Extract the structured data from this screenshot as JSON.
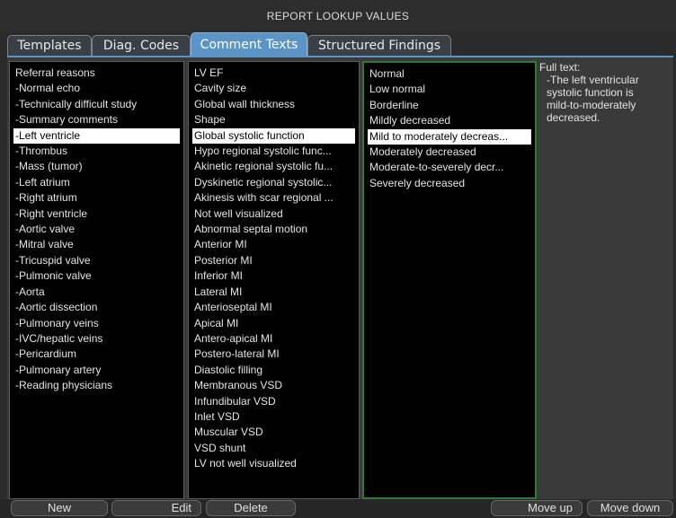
{
  "title": "REPORT LOOKUP VALUES",
  "tabs": [
    {
      "label": "Templates"
    },
    {
      "label": "Diag. Codes"
    },
    {
      "label": "Comment Texts"
    },
    {
      "label": "Structured Findings"
    }
  ],
  "col1": {
    "items": [
      "Referral reasons",
      "-Normal echo",
      "-Technically difficult study",
      "-Summary comments",
      "-Left ventricle",
      "-Thrombus",
      "-Mass (tumor)",
      "-Left atrium",
      "-Right atrium",
      "-Right ventricle",
      "-Aortic valve",
      "-Mitral valve",
      "-Tricuspid valve",
      "-Pulmonic valve",
      "-Aorta",
      "-Aortic dissection",
      "-Pulmonary veins",
      "-IVC/hepatic veins",
      "-Pericardium",
      "-Pulmonary artery",
      "-Reading physicians"
    ],
    "selected_index": 4
  },
  "col2": {
    "items": [
      "LV EF",
      "Cavity size",
      "Global wall thickness",
      "Shape",
      "Global systolic function",
      "Hypo regional systolic func...",
      "Akinetic regional systolic fu...",
      "Dyskinetic regional systolic...",
      "Akinesis with scar regional ...",
      "Not well visualized",
      "Abnormal septal motion",
      "Anterior MI",
      "Posterior MI",
      "Inferior MI",
      "Lateral MI",
      "Anterioseptal MI",
      "Apical MI",
      "Antero-apical MI",
      "Postero-lateral MI",
      "Diastolic filling",
      "Membranous VSD",
      "Infundibular VSD",
      "Inlet VSD",
      "Muscular VSD",
      "VSD shunt",
      "LV not well visualized"
    ],
    "selected_index": 4
  },
  "col3": {
    "items": [
      "Normal",
      "Low normal",
      "Borderline",
      "Mildly decreased",
      "Mild to moderately decreas...",
      "Moderately decreased",
      "Moderate-to-severely decr...",
      "Severely decreased"
    ],
    "selected_index": 4
  },
  "fulltext": {
    "label": "Full text:",
    "body": "-The left ventricular\nsystolic function is\nmild-to-moderately\ndecreased."
  },
  "buttons": {
    "new": "New",
    "edit": "Edit",
    "delete": "Delete",
    "move_up": "Move up",
    "move_down": "Move down"
  },
  "colors": {
    "active_tab": "#5b95c8",
    "selected_row": "#ffffff",
    "list_bg": "#000000",
    "active_list_border": "#2c7a35"
  }
}
